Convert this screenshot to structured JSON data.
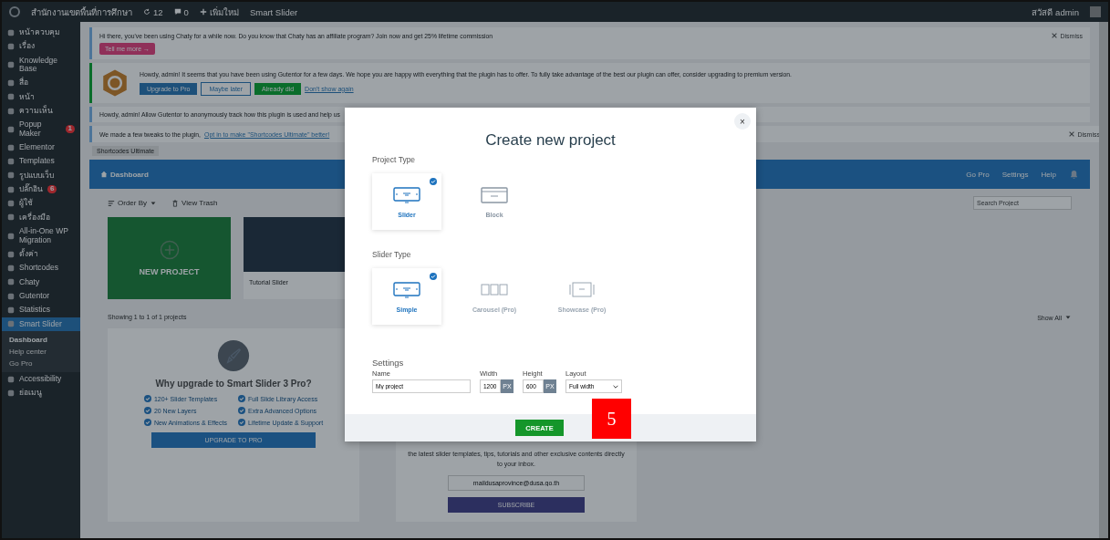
{
  "admin_bar": {
    "site_name": "สำนักงานเขตพื้นที่การศึกษา",
    "updates": "12",
    "comments": "0",
    "new": "เพิ่มใหม่",
    "plugin": "Smart Slider",
    "greeting": "สวัสดี admin"
  },
  "sidebar": {
    "items": [
      {
        "label": "หน้าควบคุม",
        "selected": false
      },
      {
        "label": "เรื่อง",
        "selected": false
      },
      {
        "label": "Knowledge Base",
        "selected": false
      },
      {
        "label": "สื่อ",
        "selected": false
      },
      {
        "label": "หน้า",
        "selected": false
      },
      {
        "label": "ความเห็น",
        "selected": false
      },
      {
        "label": "Popup Maker",
        "badge": "1",
        "selected": false
      },
      {
        "label": "Elementor",
        "selected": false
      },
      {
        "label": "Templates",
        "selected": false
      },
      {
        "label": "รูปแบบเว็บ",
        "selected": false
      },
      {
        "label": "ปลั๊กอิน",
        "badge": "6",
        "selected": false
      },
      {
        "label": "ผู้ใช้",
        "selected": false
      },
      {
        "label": "เครื่องมือ",
        "selected": false
      },
      {
        "label": "All-in-One WP Migration",
        "selected": false
      },
      {
        "label": "ตั้งค่า",
        "selected": false
      },
      {
        "label": "Shortcodes",
        "selected": false
      },
      {
        "label": "Chaty",
        "selected": false
      },
      {
        "label": "Gutentor",
        "selected": false
      },
      {
        "label": "Statistics",
        "selected": false
      },
      {
        "label": "Smart Slider",
        "selected": true,
        "children": [
          {
            "label": "Dashboard",
            "selected": true
          },
          {
            "label": "Help center",
            "selected": false
          },
          {
            "label": "Go Pro",
            "selected": false
          }
        ]
      },
      {
        "label": "Accessibility",
        "selected": false
      },
      {
        "label": "ย่อเมนู",
        "selected": false
      }
    ]
  },
  "notices": [
    {
      "kind": "chaty",
      "text": "Hi there, you've been using Chaty for a while now. Do you know that Chaty has an affiliate program? Join now and get 25% lifetime commission",
      "button": "Tell me more →",
      "dismiss": "Dismiss"
    },
    {
      "kind": "gutentor",
      "text": "Howdy, admin! It seems that you have been using Gutentor for a few days. We hope you are happy with everything that the plugin has to offer. To fully take advantage of the best our plugin can offer, consider upgrading to premium version.",
      "buttons": [
        "Upgrade to Pro",
        "Maybe later",
        "Already did"
      ],
      "link": "Don't show again"
    },
    {
      "kind": "plain",
      "text": "Howdy, admin! Allow Gutentor to anonymously track how this plugin is used and help us"
    },
    {
      "kind": "optin",
      "text": "We made a few tweaks to the plugin,",
      "link": "Opt in to make \"Shortcodes Ultimate\" better!",
      "dismiss": "Dismiss",
      "tag": "Shortcodes Ultimate"
    }
  ],
  "dashboard": {
    "title": "Dashboard",
    "nav": [
      "Go Pro",
      "Settings",
      "Help"
    ],
    "order_by": "Order By",
    "view_trash": "View Trash",
    "search": {
      "placeholder": "Search Project"
    },
    "new_project": "NEW PROJECT",
    "projects": [
      {
        "name": "Tutorial Slider"
      }
    ],
    "showing": "Showing 1 to 1 of 1 projects",
    "show_all": "Show All",
    "upgrade": {
      "title": "Why upgrade to Smart Slider 3 Pro?",
      "features": [
        "120+ Slider Templates",
        "Full Slide Library Access",
        "20 New Layers",
        "Extra Advanced Options",
        "New Animations & Effects",
        "Lifetime Update & Support"
      ],
      "button": "UPGRADE TO PRO"
    },
    "newsletter": {
      "text": "the latest slider templates, tips, tutorials and other exclusive contents directly to your inbox.",
      "email": "maildusaprovince@dusa.go.th",
      "button": "SUBSCRIBE"
    }
  },
  "modal": {
    "title": "Create new project",
    "close": "×",
    "project_type": {
      "label": "Project Type",
      "options": [
        {
          "kind": "slider",
          "label": "Slider",
          "selected": true,
          "disabled": false
        },
        {
          "kind": "block",
          "label": "Block",
          "selected": false,
          "disabled": false
        }
      ]
    },
    "slider_type": {
      "label": "Slider Type",
      "options": [
        {
          "kind": "simple",
          "label": "Simple",
          "selected": true,
          "disabled": false
        },
        {
          "kind": "carousel",
          "label": "Carousel (Pro)",
          "selected": false,
          "disabled": true
        },
        {
          "kind": "showcase",
          "label": "Showcase (Pro)",
          "selected": false,
          "disabled": true
        }
      ]
    },
    "settings": {
      "label": "Settings",
      "name": {
        "label": "Name",
        "value": "My project"
      },
      "width": {
        "label": "Width",
        "value": "1200",
        "unit": "PX"
      },
      "height": {
        "label": "Height",
        "value": "600",
        "unit": "PX"
      },
      "layout": {
        "label": "Layout",
        "value": "Full width"
      }
    },
    "create": "CREATE"
  },
  "annotation": "5"
}
